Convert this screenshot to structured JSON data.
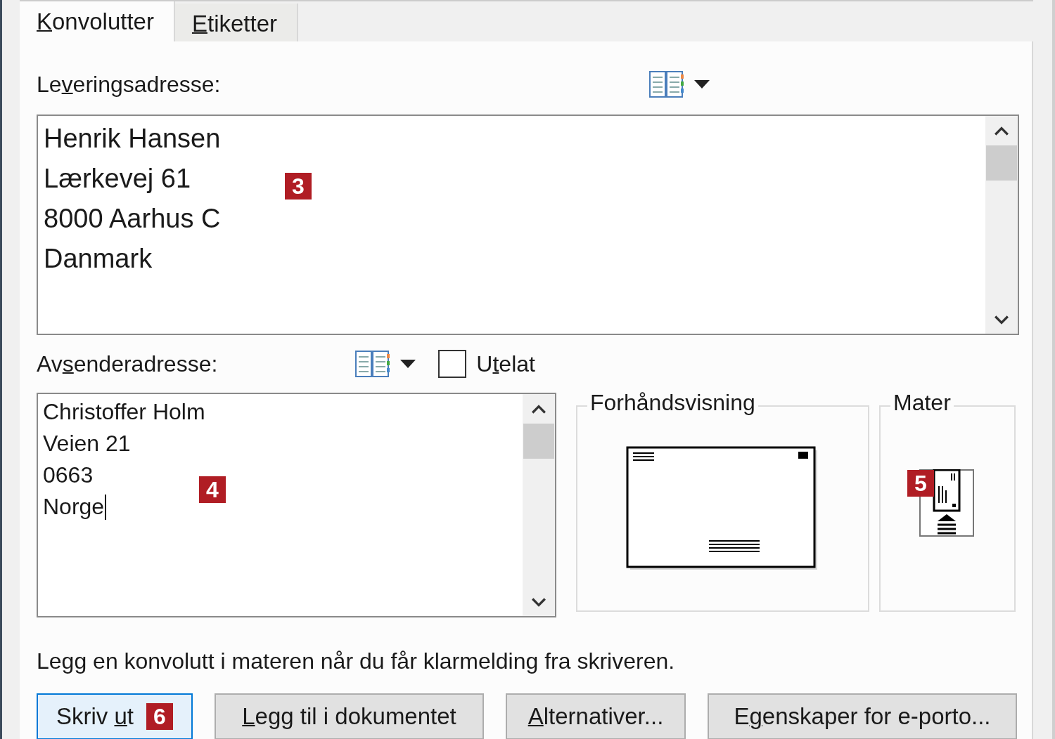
{
  "tabs": [
    {
      "label": {
        "key": "K",
        "after": "onvolutter"
      },
      "selected": true
    },
    {
      "label": {
        "key": "E",
        "after": "tiketter"
      },
      "selected": false
    }
  ],
  "delivery": {
    "label": {
      "before": "Le",
      "key": "v",
      "after": "eringsadresse:"
    },
    "lines": [
      "Henrik Hansen",
      "Lærkevej 61",
      "8000 Aarhus C",
      "Danmark"
    ],
    "badge": "3"
  },
  "return": {
    "label": {
      "before": "Av",
      "key": "s",
      "after": "enderadresse:"
    },
    "omit": {
      "label": {
        "before": "U",
        "key": "t",
        "after": "elat"
      },
      "checked": false
    },
    "lines": [
      "Christoffer Holm",
      "Veien 21",
      "0663",
      "Norge"
    ],
    "badge": "4"
  },
  "preview": {
    "title": "Forhåndsvisning"
  },
  "feed": {
    "title": "Mater",
    "badge": "5"
  },
  "instruction": "Legg en konvolutt i materen når du får klarmelding fra skriveren.",
  "buttons": [
    {
      "label": {
        "before": "Skriv ",
        "key": "u",
        "after": "t"
      },
      "focused": true,
      "badge": "6"
    },
    {
      "label": {
        "key": "L",
        "after": "egg til i dokumentet"
      },
      "focused": false
    },
    {
      "label": {
        "key": "A",
        "after": "lternativer..."
      },
      "focused": false
    },
    {
      "label": {
        "before": "E",
        "key": "g",
        "after": "enskaper for e-porto..."
      },
      "focused": false
    }
  ]
}
